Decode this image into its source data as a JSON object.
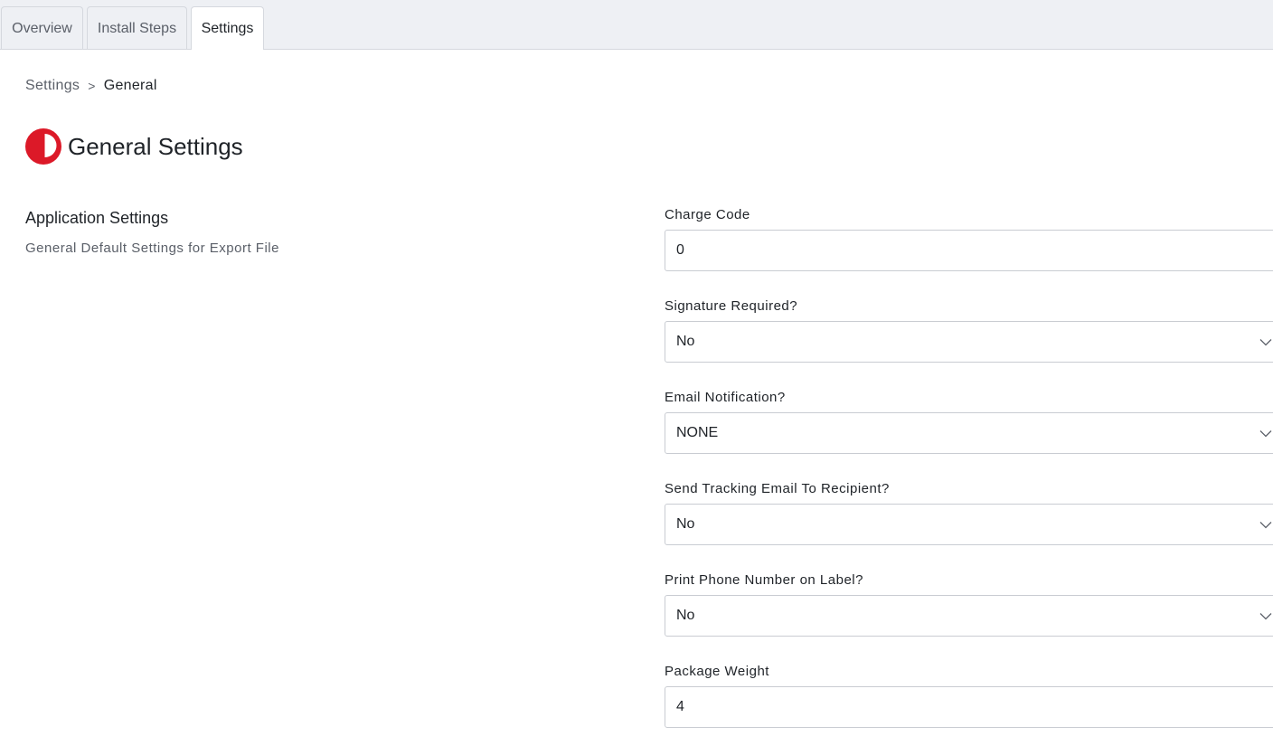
{
  "tabs": [
    {
      "label": "Overview",
      "active": false
    },
    {
      "label": "Install Steps",
      "active": false
    },
    {
      "label": "Settings",
      "active": true
    }
  ],
  "breadcrumb": {
    "parent": "Settings",
    "separator": ">",
    "current": "General"
  },
  "page": {
    "title": "General Settings",
    "logo_icon": "australia-post-logo-icon",
    "brand_color": "#dc1928"
  },
  "section": {
    "title": "Application Settings",
    "description": "General Default Settings for Export File"
  },
  "fields": [
    {
      "label": "Charge Code",
      "type": "text",
      "value": "0"
    },
    {
      "label": "Signature Required?",
      "type": "select",
      "value": "No"
    },
    {
      "label": "Email Notification?",
      "type": "select",
      "value": "NONE"
    },
    {
      "label": "Send Tracking Email To Recipient?",
      "type": "select",
      "value": "No"
    },
    {
      "label": "Print Phone Number on Label?",
      "type": "select",
      "value": "No"
    },
    {
      "label": "Package Weight",
      "type": "text",
      "value": "4"
    }
  ]
}
